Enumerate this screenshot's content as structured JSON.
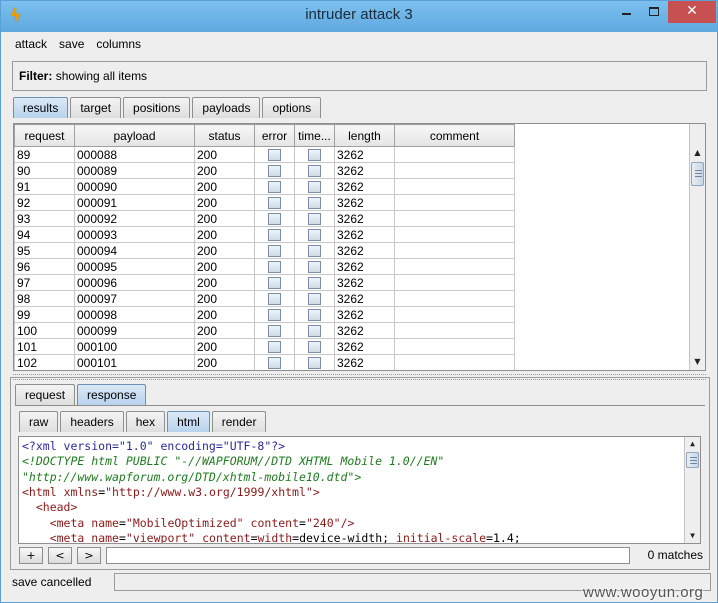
{
  "window": {
    "title": "intruder attack 3",
    "close_glyph": "✕"
  },
  "menu": [
    "attack",
    "save",
    "columns"
  ],
  "filter": {
    "label": "Filter:",
    "text": "showing all items"
  },
  "main_tabs": [
    {
      "label": "results",
      "active": true
    },
    {
      "label": "target",
      "active": false
    },
    {
      "label": "positions",
      "active": false
    },
    {
      "label": "payloads",
      "active": false
    },
    {
      "label": "options",
      "active": false
    }
  ],
  "table": {
    "columns": [
      "request",
      "payload",
      "status",
      "error",
      "time...",
      "length",
      "comment"
    ],
    "rows": [
      {
        "request": "89",
        "payload": "000088",
        "status": "200",
        "length": "3262"
      },
      {
        "request": "90",
        "payload": "000089",
        "status": "200",
        "length": "3262"
      },
      {
        "request": "91",
        "payload": "000090",
        "status": "200",
        "length": "3262"
      },
      {
        "request": "92",
        "payload": "000091",
        "status": "200",
        "length": "3262"
      },
      {
        "request": "93",
        "payload": "000092",
        "status": "200",
        "length": "3262"
      },
      {
        "request": "94",
        "payload": "000093",
        "status": "200",
        "length": "3262"
      },
      {
        "request": "95",
        "payload": "000094",
        "status": "200",
        "length": "3262"
      },
      {
        "request": "96",
        "payload": "000095",
        "status": "200",
        "length": "3262"
      },
      {
        "request": "97",
        "payload": "000096",
        "status": "200",
        "length": "3262"
      },
      {
        "request": "98",
        "payload": "000097",
        "status": "200",
        "length": "3262"
      },
      {
        "request": "99",
        "payload": "000098",
        "status": "200",
        "length": "3262"
      },
      {
        "request": "100",
        "payload": "000099",
        "status": "200",
        "length": "3262"
      },
      {
        "request": "101",
        "payload": "000100",
        "status": "200",
        "length": "3262"
      },
      {
        "request": "102",
        "payload": "000101",
        "status": "200",
        "length": "3262"
      }
    ]
  },
  "message_tabs": [
    {
      "label": "request",
      "active": false
    },
    {
      "label": "response",
      "active": true
    }
  ],
  "view_tabs": [
    {
      "label": "raw",
      "active": false
    },
    {
      "label": "headers",
      "active": false
    },
    {
      "label": "hex",
      "active": false
    },
    {
      "label": "html",
      "active": true
    },
    {
      "label": "render",
      "active": false
    }
  ],
  "response_lines": [
    "<?xml version=\"1.0\" encoding=\"UTF-8\"?>",
    "<!DOCTYPE html PUBLIC \"-//WAPFORUM//DTD XHTML Mobile 1.0//EN\"",
    "\"http://www.wapforum.org/DTD/xhtml-mobile10.dtd\">",
    "<html xmlns=\"http://www.w3.org/1999/xhtml\">",
    "  <head>",
    "    <meta name=\"MobileOptimized\" content=\"240\"/>",
    "    <meta name=\"viewport\" content=\"width=device-width; initial-scale=1.4;"
  ],
  "search": {
    "buttons": [
      "+",
      "<",
      ">"
    ],
    "value": "",
    "matches": "0 matches"
  },
  "status": {
    "text": "save cancelled"
  },
  "watermark": "www.wooyun.org"
}
